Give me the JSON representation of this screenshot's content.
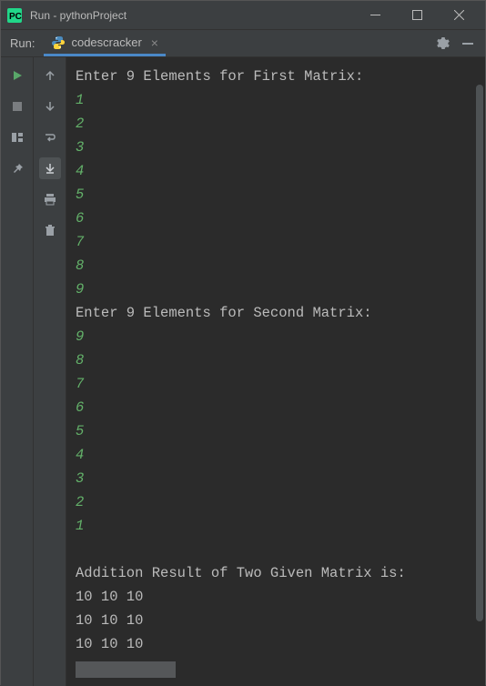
{
  "titlebar": {
    "title": "Run - pythonProject"
  },
  "toolwindow": {
    "label": "Run:",
    "tab_name": "codescracker"
  },
  "console": {
    "prompt1": "Enter 9 Elements for First Matrix:",
    "first_inputs": [
      "1",
      "2",
      "3",
      "4",
      "5",
      "6",
      "7",
      "8",
      "9"
    ],
    "prompt2": "Enter 9 Elements for Second Matrix:",
    "second_inputs": [
      "9",
      "8",
      "7",
      "6",
      "5",
      "4",
      "3",
      "2",
      "1"
    ],
    "result_header": "Addition Result of Two Given Matrix is:",
    "result_rows": [
      "10 10 10",
      "10 10 10",
      "10 10 10"
    ]
  }
}
